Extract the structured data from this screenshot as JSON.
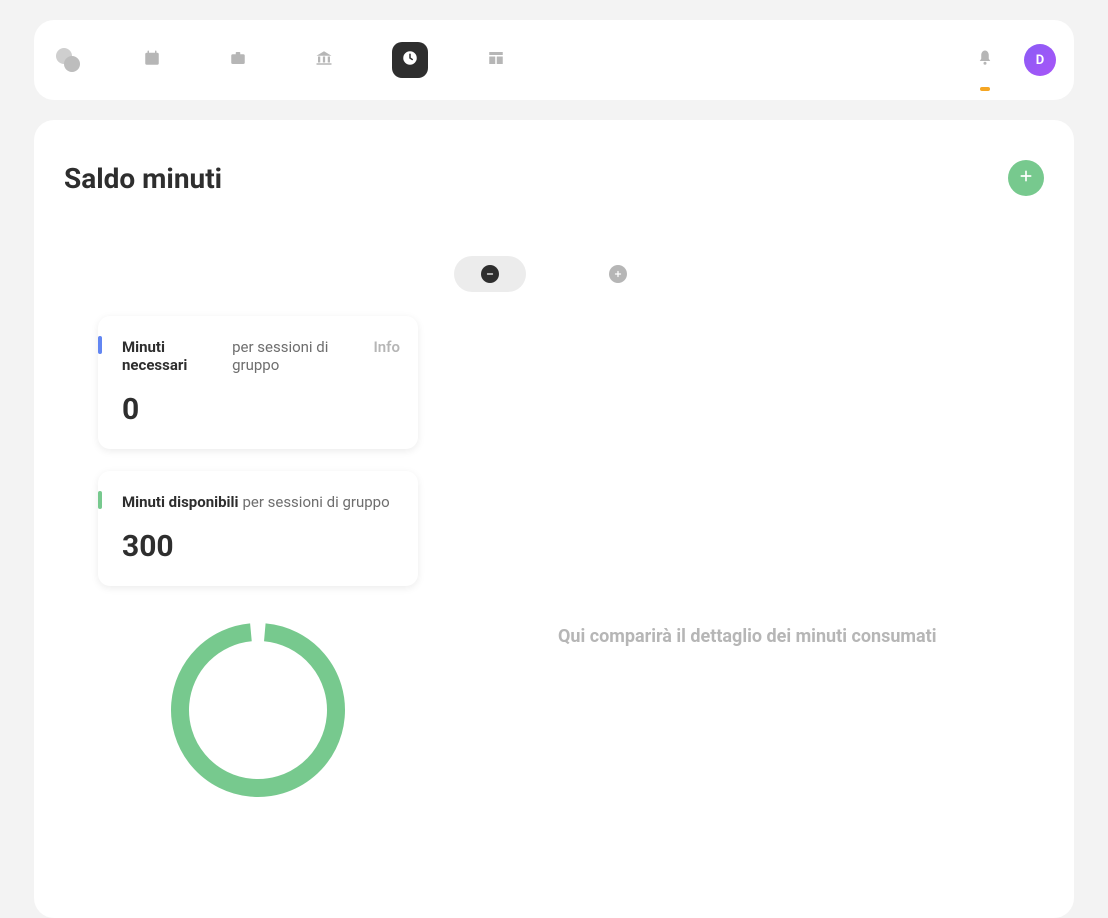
{
  "nav": {
    "icons": [
      "calendar-icon",
      "briefcase-icon",
      "bank-icon",
      "clock-icon",
      "layout-icon"
    ],
    "active_index": 3
  },
  "avatar": {
    "initial": "D"
  },
  "page": {
    "title": "Saldo minuti"
  },
  "toggle": {
    "minus_active": true
  },
  "cards": {
    "necessari": {
      "bold": "Minuti necessari",
      "rest": "per sessioni di gruppo",
      "info": "Info",
      "value": "0",
      "accent_color": "#6286f2"
    },
    "disponibili": {
      "bold": "Minuti disponibili",
      "rest": "per sessioni di gruppo",
      "value": "300",
      "accent_color": "#77c98e"
    }
  },
  "detail": {
    "empty_text": "Qui comparirà il dettaglio dei minuti consumati"
  },
  "chart_data": {
    "type": "pie",
    "title": "",
    "series": [
      {
        "name": "Minuti disponibili",
        "value": 300,
        "color": "#77c98e"
      },
      {
        "name": "Minuti necessari",
        "value": 0,
        "color": "#6286f2"
      }
    ],
    "gap_degrees": 10
  },
  "colors": {
    "green": "#77c98e",
    "blue": "#6286f2",
    "dark": "#2e2e2e",
    "grey": "#b6b6b6"
  }
}
